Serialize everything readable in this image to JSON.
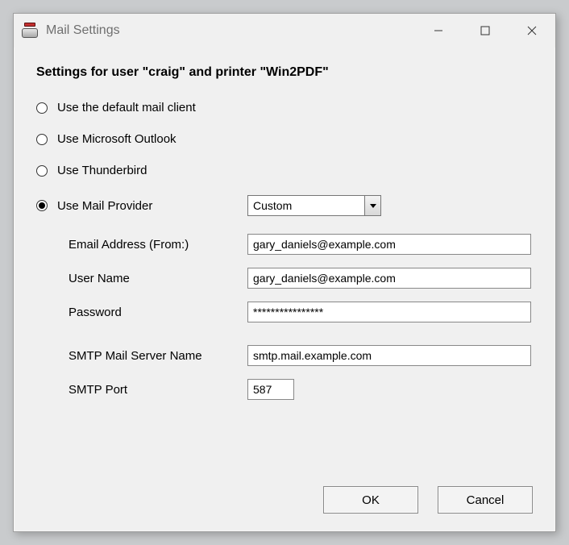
{
  "window": {
    "title": "Mail Settings"
  },
  "heading": "Settings for user \"craig\" and printer \"Win2PDF\"",
  "radios": {
    "default_client": "Use the default mail client",
    "outlook": "Use Microsoft Outlook",
    "thunderbird": "Use Thunderbird",
    "provider": "Use Mail Provider"
  },
  "provider_select": {
    "value": "Custom"
  },
  "fields": {
    "email_label": "Email Address (From:)",
    "email_value": "gary_daniels@example.com",
    "user_label": "User Name",
    "user_value": "gary_daniels@example.com",
    "password_label": "Password",
    "password_value": "****************",
    "smtp_server_label": "SMTP Mail Server Name",
    "smtp_server_value": "smtp.mail.example.com",
    "smtp_port_label": "SMTP Port",
    "smtp_port_value": "587"
  },
  "buttons": {
    "ok": "OK",
    "cancel": "Cancel"
  }
}
